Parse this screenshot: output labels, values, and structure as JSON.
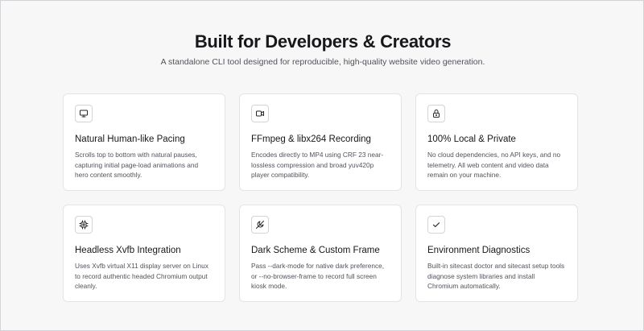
{
  "header": {
    "title": "Built for Developers & Creators",
    "subtitle": "A standalone CLI tool designed for reproducible, high-quality website video generation."
  },
  "features": [
    {
      "icon": "monitor-icon",
      "title": "Natural Human-like Pacing",
      "description": "Scrolls top to bottom with natural pauses, capturing initial page-load animations and hero content smoothly."
    },
    {
      "icon": "video-camera-icon",
      "title": "FFmpeg & libx264 Recording",
      "description": "Encodes directly to MP4 using CRF 23 near-lossless compression and broad yuv420p player compatibility."
    },
    {
      "icon": "lock-icon",
      "title": "100% Local & Private",
      "description": "No cloud dependencies, no API keys, and no telemetry. All web content and video data remain on your machine."
    },
    {
      "icon": "chip-icon",
      "title": "Headless Xvfb Integration",
      "description": "Uses Xvfb virtual X11 display server on Linux to record authentic headed Chromium output cleanly."
    },
    {
      "icon": "moon-off-icon",
      "title": "Dark Scheme & Custom Frame",
      "description": "Pass --dark-mode for native dark preference, or --no-browser-frame to record full screen kiosk mode."
    },
    {
      "icon": "check-icon",
      "title": "Environment Diagnostics",
      "description": "Built-in sitecast doctor and sitecast setup tools diagnose system libraries and install Chromium automatically."
    }
  ]
}
